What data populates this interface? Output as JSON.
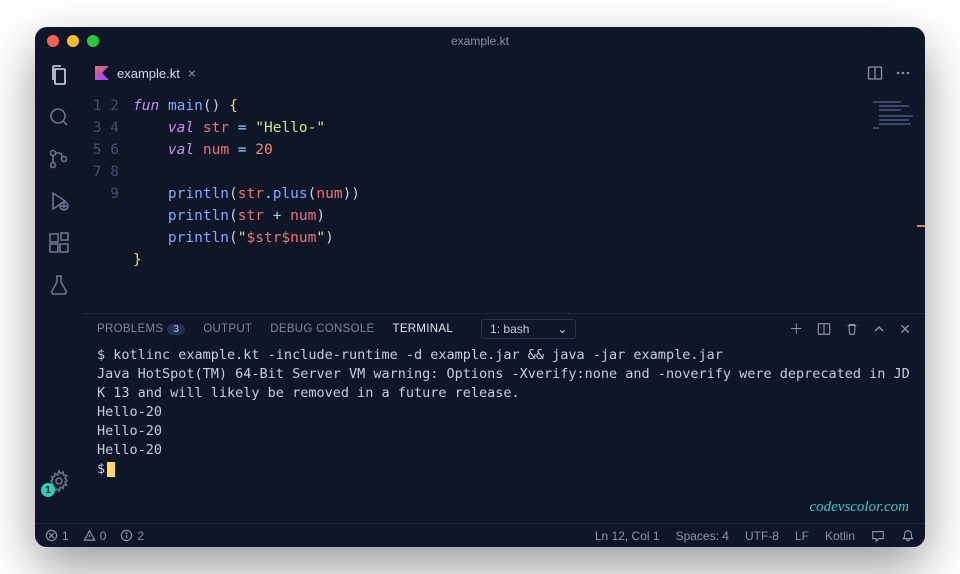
{
  "window": {
    "title": "example.kt"
  },
  "tab": {
    "filename": "example.kt"
  },
  "code_lines": [
    "1",
    "2",
    "3",
    "4",
    "5",
    "6",
    "7",
    "8",
    "9"
  ],
  "code": {
    "l1": {
      "kw": "fun",
      "fn": "main",
      "paren": "()",
      "brace": "{"
    },
    "l2": {
      "kw": "val",
      "id": "str",
      "op": "=",
      "str": "\"Hello-\""
    },
    "l3": {
      "kw": "val",
      "id": "num",
      "op": "=",
      "num": "20"
    },
    "l5": {
      "fn": "println",
      "open": "(",
      "id": "str",
      "dot": ".",
      "m": "plus",
      "open2": "(",
      "arg": "num",
      "close2": ")",
      "close": ")"
    },
    "l6": {
      "fn": "println",
      "open": "(",
      "a": "str",
      "op": "+",
      "b": "num",
      "close": ")"
    },
    "l7": {
      "fn": "println",
      "open": "(",
      "q1": "\"",
      "t1": "$str",
      "t2": "$num",
      "q2": "\"",
      "close": ")"
    },
    "l8": {
      "brace": "}"
    }
  },
  "panel": {
    "tabs": {
      "problems": "PROBLEMS",
      "problems_count": "3",
      "output": "OUTPUT",
      "debug": "DEBUG CONSOLE",
      "terminal": "TERMINAL"
    },
    "term_select": "1: bash"
  },
  "terminal": {
    "l1": "$ kotlinc example.kt -include-runtime -d example.jar && java -jar example.jar",
    "l2": "Java HotSpot(TM) 64-Bit Server VM warning: Options -Xverify:none and -noverify were deprecated in JDK 13 and will likely be removed in a future release.",
    "l3": "Hello-20",
    "l4": "Hello-20",
    "l5": "Hello-20",
    "prompt": "$"
  },
  "watermark": "codevscolor.com",
  "status": {
    "errors": "1",
    "warnings": "0",
    "info": "2",
    "lncol": "Ln 12, Col 1",
    "spaces": "Spaces: 4",
    "encoding": "UTF-8",
    "eol": "LF",
    "lang": "Kotlin"
  },
  "activity": {
    "settings_badge": "1"
  }
}
